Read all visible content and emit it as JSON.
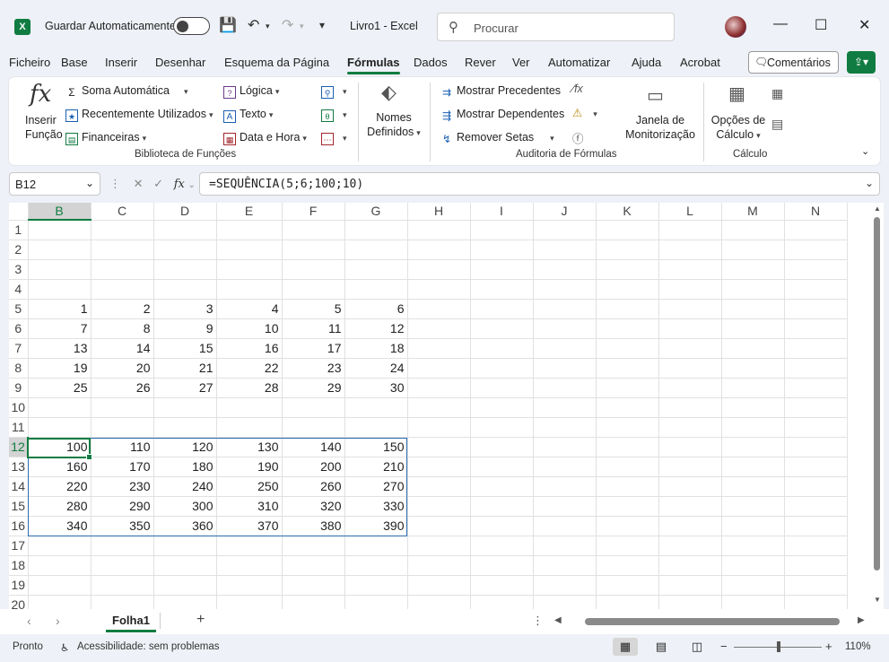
{
  "titlebar": {
    "logo": "X",
    "autosave_label": "Guardar Automaticamente",
    "doc_title": "Livro1  -  Excel",
    "search_placeholder": "Procurar",
    "save_icon": "💾",
    "undo_icon": "↶",
    "redo_icon": "↷",
    "customize_icon": "▾",
    "minimize": "—",
    "maximize": "☐",
    "close": "✕"
  },
  "ribbon_tabs": [
    "Ficheiro",
    "Base",
    "Inserir",
    "Desenhar",
    "Esquema da Página",
    "Fórmulas",
    "Dados",
    "Rever",
    "Ver",
    "Automatizar",
    "Ajuda",
    "Acrobat"
  ],
  "active_tab": "Fórmulas",
  "comments_label": "Comentários",
  "ribbon": {
    "insert_fn_line1": "Inserir",
    "insert_fn_line2": "Função",
    "autosum": "Soma Automática",
    "recent": "Recentemente Utilizados",
    "financial": "Financeiras",
    "logical": "Lógica",
    "text": "Texto",
    "datetime": "Data e Hora",
    "names_line1": "Nomes",
    "names_line2": "Definidos",
    "trace_prec": "Mostrar Precedentes",
    "trace_dep": "Mostrar Dependentes",
    "remove_arrows": "Remover Setas",
    "watch_line1": "Janela de",
    "watch_line2": "Monitorização",
    "calc_opts_line1": "Opções de",
    "calc_opts_line2": "Cálculo",
    "group_fn_lib": "Biblioteca de Funções",
    "group_audit": "Auditoria de Fórmulas",
    "group_calc": "Cálculo"
  },
  "formula_bar": {
    "name_box": "B12",
    "formula": "=SEQUÊNCIA(5;6;100;10)"
  },
  "columns": [
    "B",
    "C",
    "D",
    "E",
    "F",
    "G",
    "H",
    "I",
    "J",
    "K",
    "L",
    "M",
    "N"
  ],
  "rows": [
    {
      "n": "1",
      "cells": [
        "",
        "",
        "",
        "",
        "",
        ""
      ]
    },
    {
      "n": "2",
      "cells": [
        "",
        "",
        "",
        "",
        "",
        ""
      ]
    },
    {
      "n": "3",
      "cells": [
        "",
        "",
        "",
        "",
        "",
        ""
      ]
    },
    {
      "n": "4",
      "cells": [
        "",
        "",
        "",
        "",
        "",
        ""
      ]
    },
    {
      "n": "5",
      "cells": [
        "1",
        "2",
        "3",
        "4",
        "5",
        "6"
      ]
    },
    {
      "n": "6",
      "cells": [
        "7",
        "8",
        "9",
        "10",
        "11",
        "12"
      ]
    },
    {
      "n": "7",
      "cells": [
        "13",
        "14",
        "15",
        "16",
        "17",
        "18"
      ]
    },
    {
      "n": "8",
      "cells": [
        "19",
        "20",
        "21",
        "22",
        "23",
        "24"
      ]
    },
    {
      "n": "9",
      "cells": [
        "25",
        "26",
        "27",
        "28",
        "29",
        "30"
      ]
    },
    {
      "n": "10",
      "cells": [
        "",
        "",
        "",
        "",
        "",
        ""
      ]
    },
    {
      "n": "11",
      "cells": [
        "",
        "",
        "",
        "",
        "",
        ""
      ]
    },
    {
      "n": "12",
      "cells": [
        "100",
        "110",
        "120",
        "130",
        "140",
        "150"
      ]
    },
    {
      "n": "13",
      "cells": [
        "160",
        "170",
        "180",
        "190",
        "200",
        "210"
      ]
    },
    {
      "n": "14",
      "cells": [
        "220",
        "230",
        "240",
        "250",
        "260",
        "270"
      ]
    },
    {
      "n": "15",
      "cells": [
        "280",
        "290",
        "300",
        "310",
        "320",
        "330"
      ]
    },
    {
      "n": "16",
      "cells": [
        "340",
        "350",
        "360",
        "370",
        "380",
        "390"
      ]
    },
    {
      "n": "17",
      "cells": [
        "",
        "",
        "",
        "",
        "",
        ""
      ]
    },
    {
      "n": "18",
      "cells": [
        "",
        "",
        "",
        "",
        "",
        ""
      ]
    },
    {
      "n": "19",
      "cells": [
        "",
        "",
        "",
        "",
        "",
        ""
      ]
    },
    {
      "n": "20",
      "cells": [
        "",
        "",
        "",
        "",
        "",
        ""
      ]
    }
  ],
  "sheet_tab": "Folha1",
  "status": {
    "ready": "Pronto",
    "accessibility": "Acessibilidade: sem problemas",
    "zoom": "110%"
  },
  "colors": {
    "accent": "#107c41",
    "selection_border": "#2b6cb0"
  }
}
